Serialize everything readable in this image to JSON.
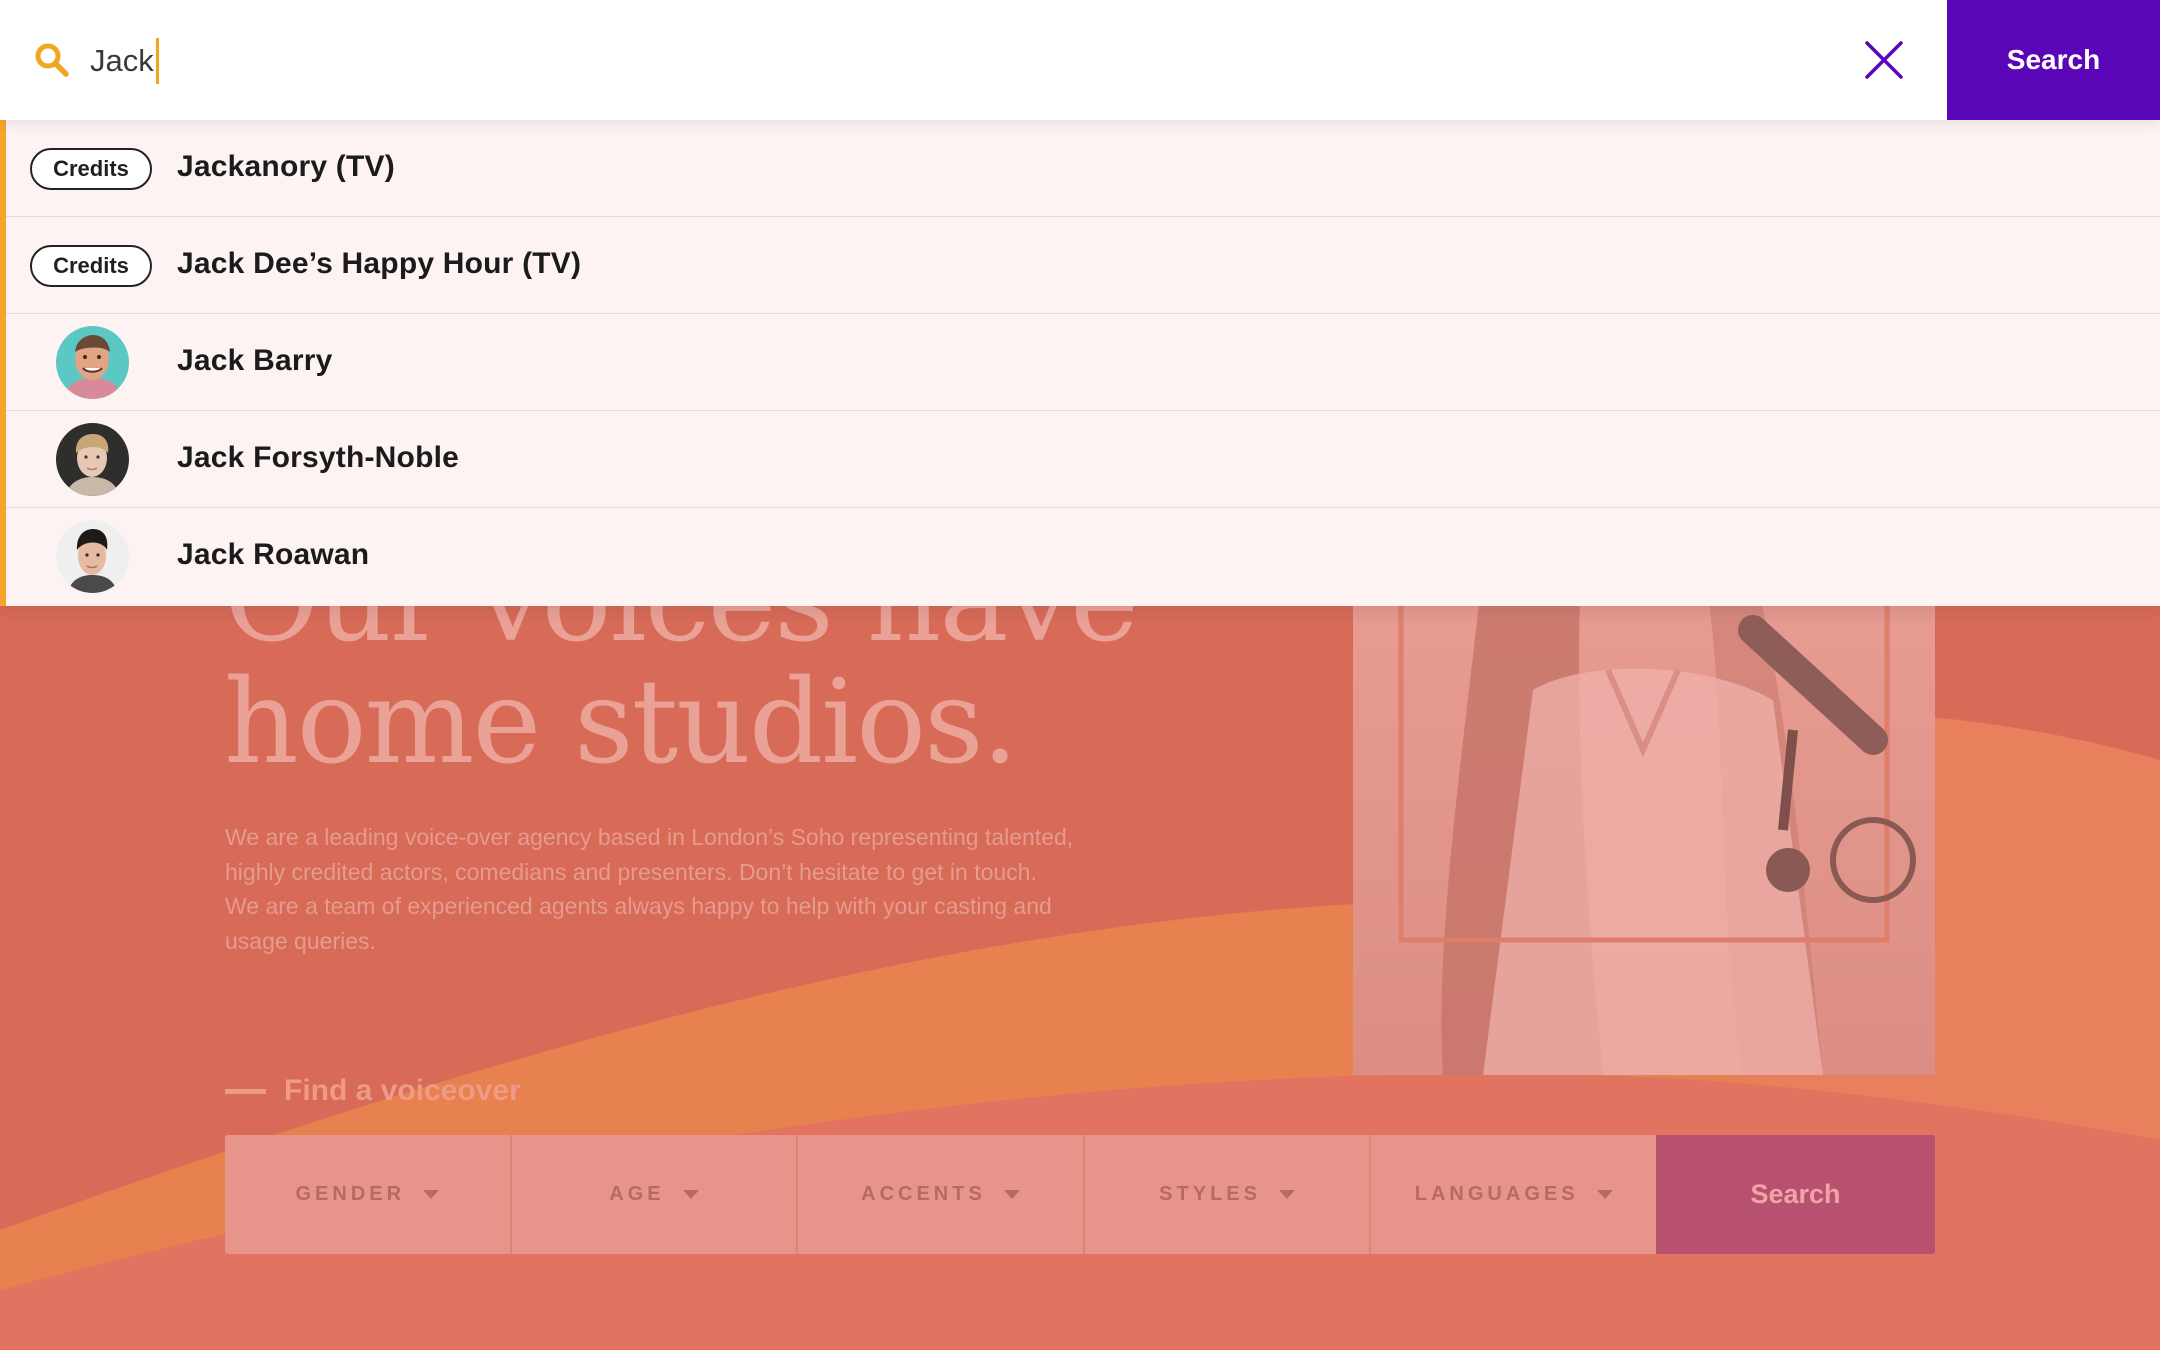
{
  "search": {
    "query": "Jack",
    "button_label": "Search"
  },
  "results": [
    {
      "type": "credit",
      "badge": "Credits",
      "label": "Jackanory (TV)"
    },
    {
      "type": "credit",
      "badge": "Credits",
      "label": "Jack Dee’s Happy Hour (TV)"
    },
    {
      "type": "person",
      "label": "Jack Barry"
    },
    {
      "type": "person",
      "label": "Jack Forsyth-Noble"
    },
    {
      "type": "person",
      "label": "Jack Roawan"
    }
  ],
  "hero": {
    "title_line1": "Our voices have",
    "title_line2": "home studios.",
    "body": "We are a leading voice-over agency based in London’s Soho representing talented, highly credited actors, comedians and presenters. Don’t hesitate to get in touch. We are a team of experienced agents always happy to help with your casting and usage queries."
  },
  "finder": {
    "label": "Find a voiceover",
    "filters": [
      "GENDER",
      "AGE",
      "ACCENTS",
      "STYLES",
      "LANGUAGES"
    ],
    "search_label": "Search"
  },
  "colors": {
    "accent_purple": "#5a06b8",
    "accent_orange": "#f4a52a",
    "page_coral": "#d86a58",
    "finder_search": "#b8506f"
  },
  "icons": {
    "search": "search-icon",
    "close": "close-icon",
    "dropdown": "caret-down-icon"
  }
}
